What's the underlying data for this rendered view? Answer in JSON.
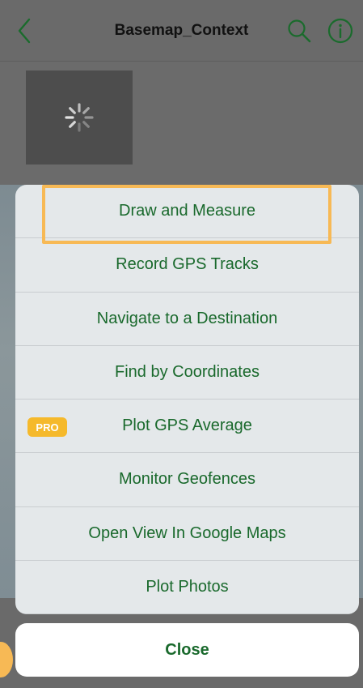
{
  "navbar": {
    "title": "Basemap_Context",
    "back_icon": "chevron-left-icon",
    "search_icon": "search-icon",
    "info_icon": "info-icon"
  },
  "thumbnail": {
    "spinner_icon": "loading-spinner-icon"
  },
  "sheet": {
    "items": [
      {
        "label": "Draw and Measure",
        "highlighted": true
      },
      {
        "label": "Record GPS Tracks"
      },
      {
        "label": "Navigate to a Destination"
      },
      {
        "label": "Find by Coordinates"
      },
      {
        "label": "Plot GPS Average",
        "badge": "PRO"
      },
      {
        "label": "Monitor Geofences"
      },
      {
        "label": "Open View In Google Maps"
      },
      {
        "label": "Plot Photos"
      }
    ]
  },
  "close_button": {
    "label": "Close"
  },
  "colors": {
    "accent_green": "#19692c",
    "highlight_orange": "#f7b955",
    "pro_badge": "#f5b92b"
  }
}
